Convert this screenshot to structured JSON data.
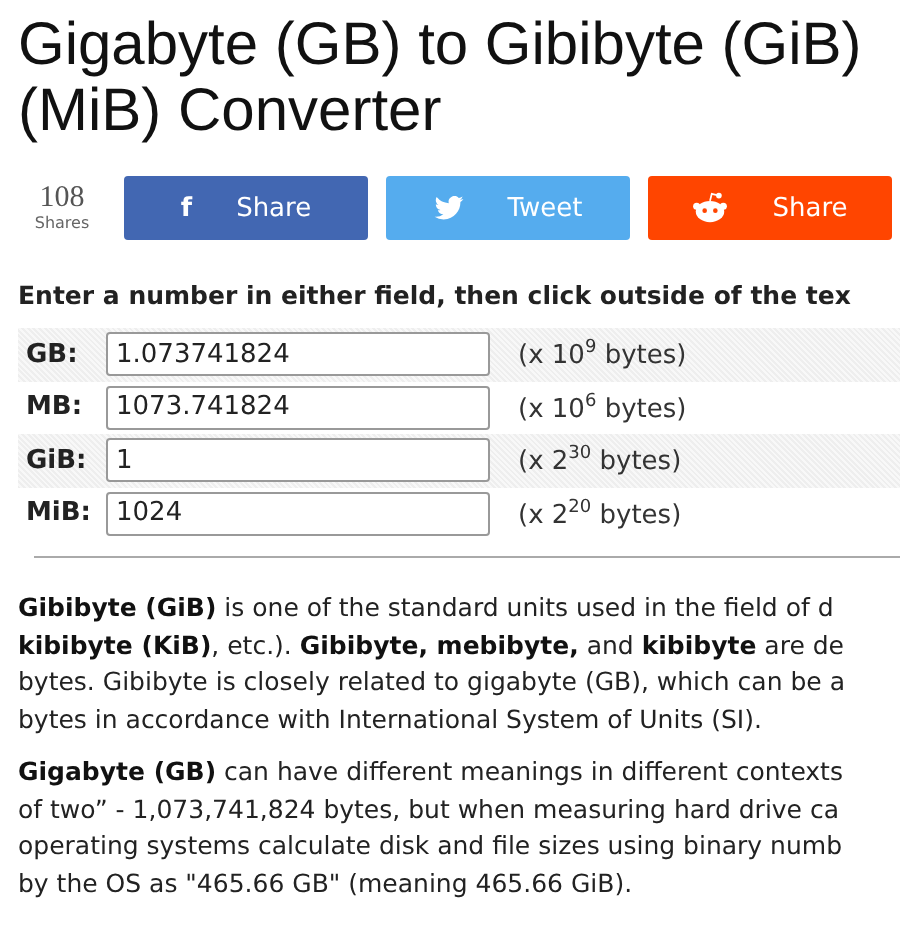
{
  "title": "Gigabyte (GB) to Gibibyte (GiB) (MiB) Converter",
  "shares": {
    "count": "108",
    "label": "Shares"
  },
  "share_buttons": [
    {
      "kind": "facebook",
      "label": "Share",
      "icon": "f"
    },
    {
      "kind": "twitter",
      "label": "Tweet"
    },
    {
      "kind": "reddit",
      "label": "Share"
    }
  ],
  "instruction": "Enter a number in either field, then click outside of the tex",
  "fields": [
    {
      "label": "GB:",
      "value": "1.073741824",
      "unit": "(x 10$^{9}$ bytes)"
    },
    {
      "label": "MB:",
      "value": "1073.741824",
      "unit": "(x 10$^{6}$ bytes)"
    },
    {
      "label": "GiB:",
      "value": "1",
      "unit": "(x 2$^{30}$ bytes)"
    },
    {
      "label": "MiB:",
      "value": "1024",
      "unit": "(x 2$^{20}$ bytes)"
    }
  ],
  "paragraphs": [
    [
      "**Gibibyte (GiB)** is one of the standard units used in the field of d",
      "**kibibyte (KiB)**, etc.). **Gibibyte, mebibyte,** and **kibibyte** are de",
      "bytes. Gibibyte is closely related to gigabyte (GB), which can be a",
      "bytes in accordance with International System of Units (SI)."
    ],
    [
      "**Gigabyte (GB)** can have different meanings in different contexts",
      "of two” - 1,073,741,824 bytes, but when measuring hard drive ca",
      "operating systems calculate disk and file sizes using binary numb",
      "by the OS as \"465.66 GB\" (meaning 465.66 GiB)."
    ]
  ]
}
